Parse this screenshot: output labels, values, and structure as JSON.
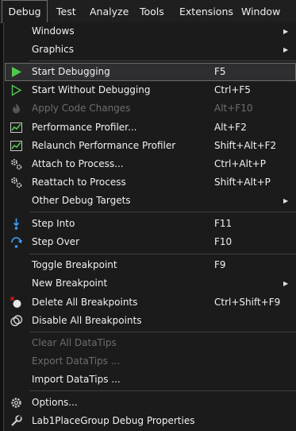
{
  "menubar": {
    "items": [
      "Debug",
      "Test",
      "Analyze",
      "Tools",
      "Extensions",
      "Window"
    ]
  },
  "debug_menu": {
    "windows": "Windows",
    "graphics": "Graphics",
    "start_debugging": {
      "label": "Start Debugging",
      "shortcut": "F5"
    },
    "start_without_debugging": {
      "label": "Start Without Debugging",
      "shortcut": "Ctrl+F5"
    },
    "apply_code_changes": {
      "label": "Apply Code Changes",
      "shortcut": "Alt+F10"
    },
    "performance_profiler": {
      "label": "Performance Profiler...",
      "shortcut": "Alt+F2"
    },
    "relaunch_profiler": {
      "label": "Relaunch Performance Profiler",
      "shortcut": "Shift+Alt+F2"
    },
    "attach_to_process": {
      "label": "Attach to Process...",
      "shortcut": "Ctrl+Alt+P"
    },
    "reattach_to_process": {
      "label": "Reattach to Process",
      "shortcut": "Shift+Alt+P"
    },
    "other_debug_targets": "Other Debug Targets",
    "step_into": {
      "label": "Step Into",
      "shortcut": "F11"
    },
    "step_over": {
      "label": "Step Over",
      "shortcut": "F10"
    },
    "toggle_breakpoint": {
      "label": "Toggle Breakpoint",
      "shortcut": "F9"
    },
    "new_breakpoint": "New Breakpoint",
    "delete_all_breakpoints": {
      "label": "Delete All Breakpoints",
      "shortcut": "Ctrl+Shift+F9"
    },
    "disable_all_breakpoints": "Disable All Breakpoints",
    "clear_all_datatips": "Clear All DataTips",
    "export_datatips": "Export DataTips ...",
    "import_datatips": "Import DataTips ...",
    "options": "Options...",
    "debug_properties": "Lab1PlaceGroup Debug Properties"
  },
  "colors": {
    "play_green": "#4ec94e",
    "step_blue": "#3c9ef4",
    "breakpoint_red": "#e51400",
    "menu_bg": "#1b1b1c",
    "highlight_bg": "#2e2e30",
    "disabled_text": "#6d6d6d"
  }
}
